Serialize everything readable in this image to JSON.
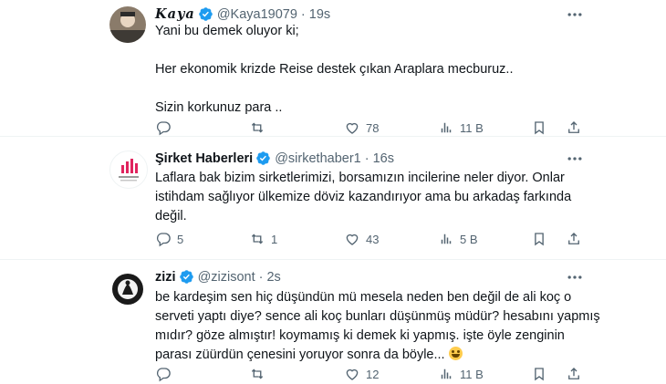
{
  "tweets": [
    {
      "name": "Kaya",
      "handle": "@Kaya19079",
      "time": "19s",
      "lines": [
        "Yani bu demek oluyor ki;",
        "",
        "Her ekonomik krizde Reise destek çıkan Araplara mecburuz..",
        "",
        "Sizin korkunuz para .."
      ],
      "stats": {
        "replies": "",
        "retweets": "",
        "likes": "78",
        "views": "11 B"
      }
    },
    {
      "name": "Şirket Haberleri",
      "handle": "@sirkethaber1",
      "time": "16s",
      "lines": [
        "Laflara bak bizim sirketlerimizi, borsamızın incilerine neler diyor. Onlar",
        "istihdam sağlıyor ülkemize döviz kazandırıyor ama bu arkadaş farkında",
        "değil."
      ],
      "stats": {
        "replies": "5",
        "retweets": "1",
        "likes": "43",
        "views": "5 B"
      }
    },
    {
      "name": "zizi",
      "handle": "@zizisont",
      "time": "2s",
      "lines": [
        "be kardeşim sen hiç düşündün mü mesela neden ben değil de ali koç o",
        "serveti yaptı diye? sence ali koç bunları düşünmüş müdür? hesabını yapmış",
        "mıdır? göze almıştır! koymamış ki demek ki yapmış. işte öyle zenginin",
        "parası züürdün çenesini yoruyor sonra da böyle..."
      ],
      "stats": {
        "replies": "",
        "retweets": "",
        "likes": "12",
        "views": "11 B"
      }
    }
  ],
  "colors": {
    "verified": "#1d9bf0",
    "secondary": "#536471",
    "separator": "#eff3f4"
  },
  "icons": [
    "more-icon",
    "reply-icon",
    "retweet-icon",
    "like-icon",
    "views-icon",
    "bookmark-icon",
    "share-icon",
    "verified-badge-icon",
    "grinning-emoji-icon"
  ]
}
